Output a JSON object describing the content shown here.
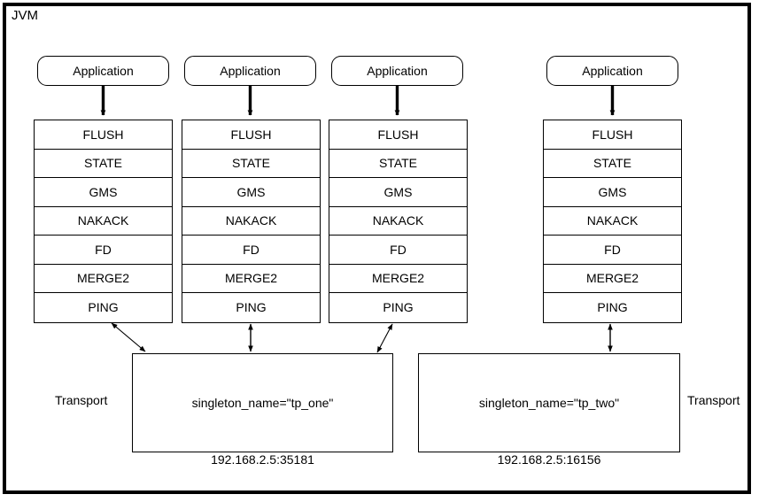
{
  "diagram": {
    "container_label": "JVM",
    "applications": [
      {
        "label": "Application"
      },
      {
        "label": "Application"
      },
      {
        "label": "Application"
      },
      {
        "label": "Application"
      }
    ],
    "protocol_stacks": [
      {
        "layers": [
          "FLUSH",
          "STATE",
          "GMS",
          "NAKACK",
          "FD",
          "MERGE2",
          "PING"
        ]
      },
      {
        "layers": [
          "FLUSH",
          "STATE",
          "GMS",
          "NAKACK",
          "FD",
          "MERGE2",
          "PING"
        ]
      },
      {
        "layers": [
          "FLUSH",
          "STATE",
          "GMS",
          "NAKACK",
          "FD",
          "MERGE2",
          "PING"
        ]
      },
      {
        "layers": [
          "FLUSH",
          "STATE",
          "GMS",
          "NAKACK",
          "FD",
          "MERGE2",
          "PING"
        ]
      }
    ],
    "transports": [
      {
        "label": "singleton_name=\"tp_one\"",
        "address": "192.168.2.5:35181",
        "side_label": "Transport"
      },
      {
        "label": "singleton_name=\"tp_two\"",
        "address": "192.168.2.5:16156",
        "side_label": "Transport"
      }
    ],
    "colors": {
      "line": "#000000",
      "background": "#ffffff",
      "text": "#000000"
    }
  }
}
